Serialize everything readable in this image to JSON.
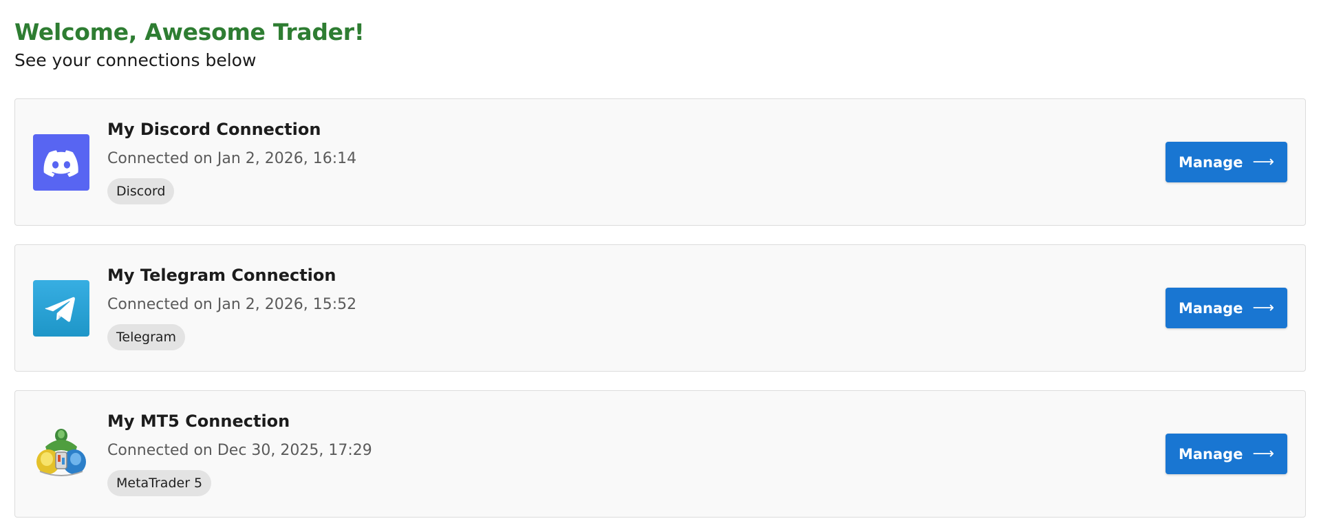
{
  "header": {
    "title": "Welcome, Awesome Trader!",
    "subtitle": "See your connections below"
  },
  "connections": [
    {
      "name": "My Discord Connection",
      "date": "Connected on Jan 2, 2026, 16:14",
      "badge": "Discord",
      "icon": "discord-icon",
      "icon_bg": "#5865F2",
      "button_label": "Manage",
      "button_arrow": "⟶"
    },
    {
      "name": "My Telegram Connection",
      "date": "Connected on Jan 2, 2026, 15:52",
      "badge": "Telegram",
      "icon": "telegram-icon",
      "icon_bg": "#2AABEE",
      "button_label": "Manage",
      "button_arrow": "⟶"
    },
    {
      "name": "My MT5 Connection",
      "date": "Connected on Dec 30, 2025, 17:29",
      "badge": "MetaTrader 5",
      "icon": "metatrader5-icon",
      "icon_bg": "transparent",
      "button_label": "Manage",
      "button_arrow": "⟶"
    }
  ],
  "colors": {
    "title_green": "#2e7d32",
    "button_blue": "#1976d2",
    "card_bg": "#f9f9f9",
    "badge_bg": "#e3e3e3"
  }
}
